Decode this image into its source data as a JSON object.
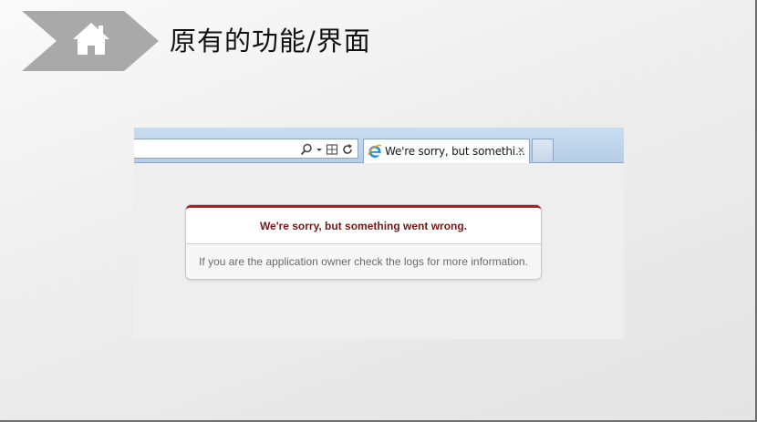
{
  "slide": {
    "title": "原有的功能/界面",
    "home_icon": "home-icon",
    "badge_color": "#a9a9a9"
  },
  "browser": {
    "tab_title": "We're sorry, but somethi...",
    "tab_close": "×",
    "address_icons": [
      "search-icon",
      "dropdown-caret-icon",
      "compatibility-view-icon",
      "refresh-icon"
    ],
    "favicon": "ie-logo-icon"
  },
  "error": {
    "heading": "We're sorry, but something went wrong.",
    "message": "If you are the application owner check the logs for more information.",
    "accent_color": "#b01b1b"
  }
}
